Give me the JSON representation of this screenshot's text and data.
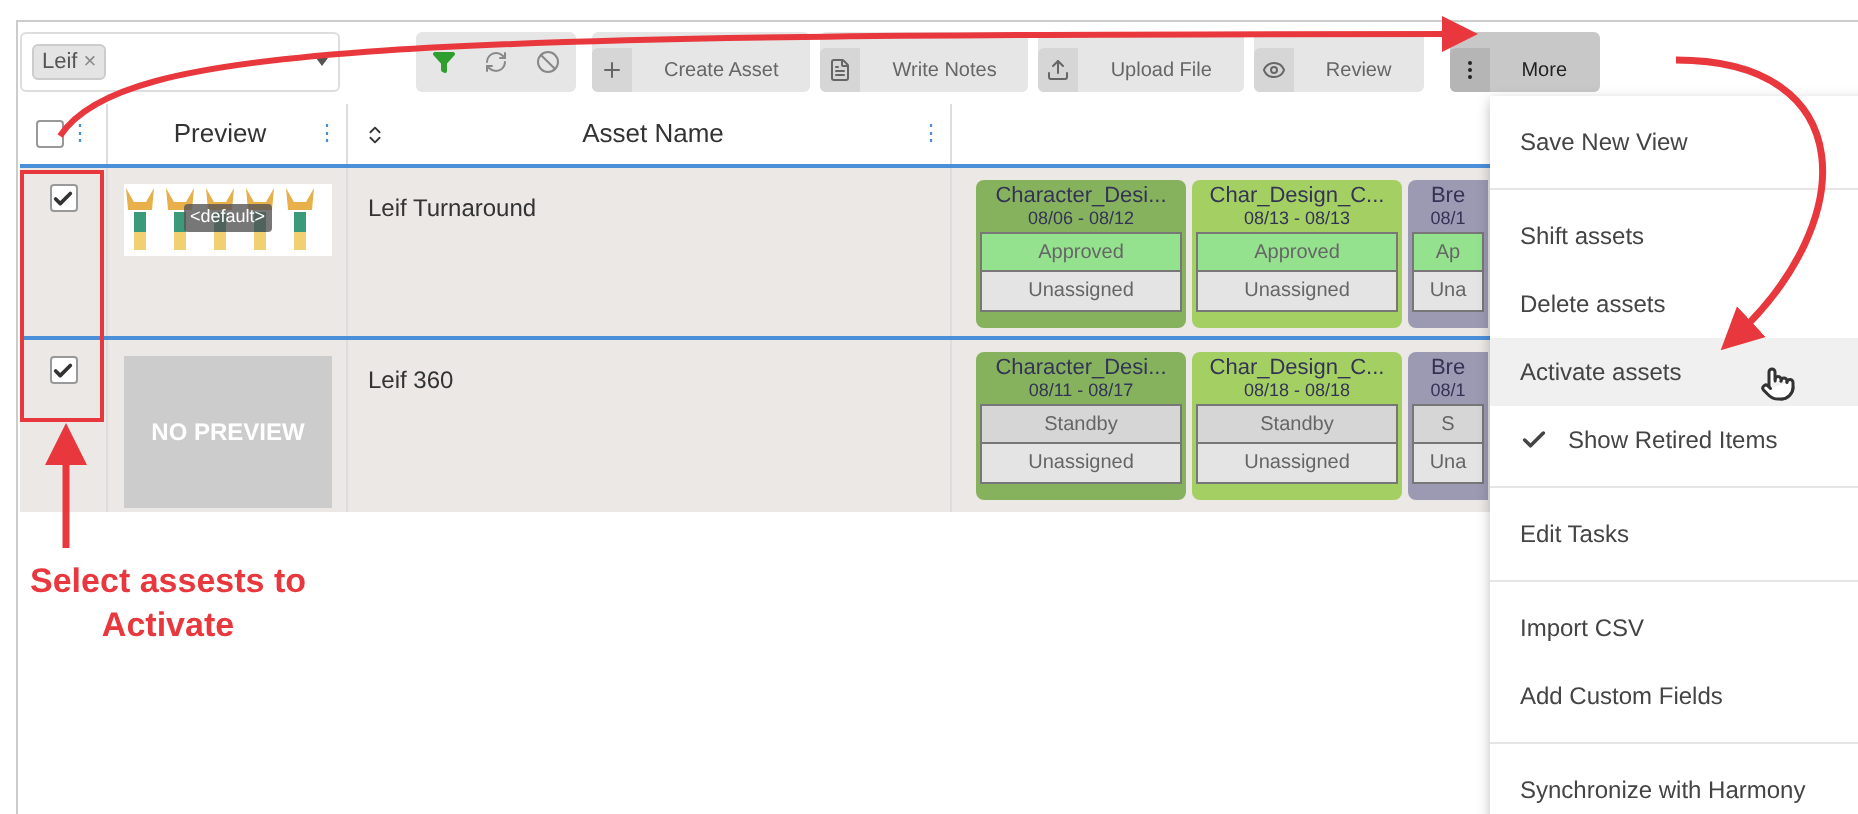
{
  "filter": {
    "tag": "Leif",
    "remove": "×"
  },
  "toolbar": {
    "buttons": [
      {
        "kind": "create",
        "label": "Create Asset",
        "active": false
      },
      {
        "kind": "notes",
        "label": "Write Notes",
        "active": false
      },
      {
        "kind": "upload",
        "label": "Upload File",
        "active": false
      },
      {
        "kind": "review",
        "label": "Review",
        "active": false
      },
      {
        "kind": "more",
        "label": "More",
        "active": true
      }
    ]
  },
  "table": {
    "header_checked": false,
    "columns": [
      "Preview",
      "Asset Name"
    ],
    "column_menus": [
      "⋮",
      "⋮",
      "⋮"
    ],
    "rows": [
      {
        "checked": true,
        "preview": {
          "kind": "picture",
          "label": "<default>"
        },
        "name": "Leif Turnaround",
        "tasks": [
          {
            "title": "Character_Desi...",
            "dates": "08/06 - 08/12",
            "color": "#86b25e",
            "status": {
              "kind": "approved",
              "text": "Approved"
            },
            "assignee": "Unassigned"
          },
          {
            "title": "Char_Design_C...",
            "dates": "08/13 - 08/13",
            "color": "#a4cf63",
            "status": {
              "kind": "approved",
              "text": "Approved"
            },
            "assignee": "Unassigned"
          },
          {
            "title": "Bre",
            "dates": "08/1",
            "color": "#9c99b3",
            "status": {
              "kind": "approved",
              "text": "Ap"
            },
            "assignee": "Una"
          }
        ]
      },
      {
        "checked": true,
        "preview": {
          "kind": "none",
          "label": "NO PREVIEW"
        },
        "name": "Leif 360",
        "tasks": [
          {
            "title": "Character_Desi...",
            "dates": "08/11 - 08/17",
            "color": "#86b25e",
            "status": {
              "kind": "standby",
              "text": "Standby"
            },
            "assignee": "Unassigned"
          },
          {
            "title": "Char_Design_C...",
            "dates": "08/18 - 08/18",
            "color": "#a4cf63",
            "status": {
              "kind": "standby",
              "text": "Standby"
            },
            "assignee": "Unassigned"
          },
          {
            "title": "Bre",
            "dates": "08/1",
            "color": "#9c99b3",
            "status": {
              "kind": "standby",
              "text": "S"
            },
            "assignee": "Una"
          }
        ]
      }
    ]
  },
  "menu": {
    "groups": [
      [
        {
          "label": "Save New View",
          "hovered": false,
          "checked": false
        }
      ],
      [
        {
          "label": "Shift assets",
          "hovered": false,
          "checked": false
        },
        {
          "label": "Delete assets",
          "hovered": false,
          "checked": false
        },
        {
          "label": "Activate assets",
          "hovered": true,
          "checked": false
        },
        {
          "label": "Show Retired Items",
          "hovered": false,
          "checked": true
        }
      ],
      [
        {
          "label": "Edit Tasks",
          "hovered": false,
          "checked": false
        }
      ],
      [
        {
          "label": "Import CSV",
          "hovered": false,
          "checked": false
        },
        {
          "label": "Add Custom Fields",
          "hovered": false,
          "checked": false
        }
      ],
      [
        {
          "label": "Synchronize with Harmony",
          "hovered": false,
          "checked": false
        }
      ]
    ]
  },
  "annotation": {
    "text": "Select assests to Activate"
  }
}
